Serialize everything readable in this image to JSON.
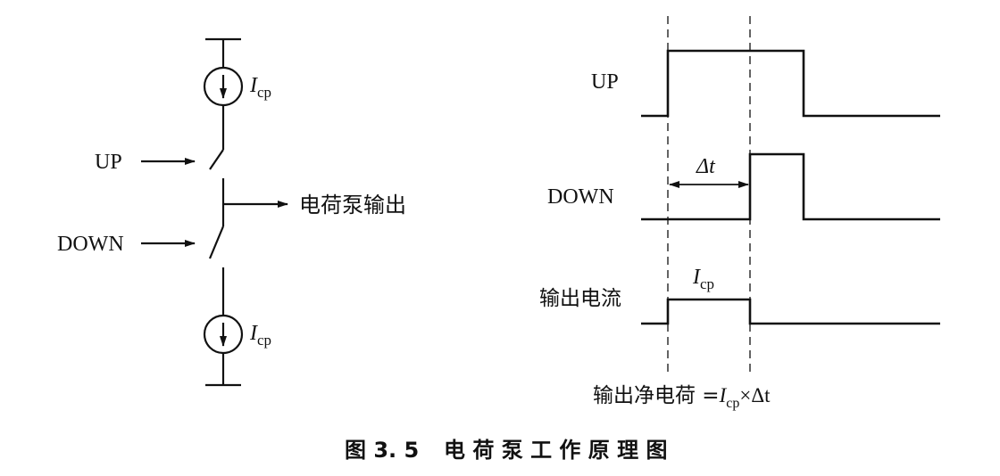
{
  "circuit": {
    "source_top_label": "I",
    "source_top_sub": "cp",
    "source_bottom_label": "I",
    "source_bottom_sub": "cp",
    "up_label": "UP",
    "down_label": "DOWN",
    "output_label": "电荷泵输出"
  },
  "timing": {
    "up_label": "UP",
    "down_label": "DOWN",
    "output_label": "输出电流",
    "delta_t": "Δt",
    "icp_main": "I",
    "icp_sub": "cp",
    "formula_prefix": "输出净电荷 =",
    "formula_i": "I",
    "formula_sub": "cp",
    "formula_suffix": "×Δt"
  },
  "caption": {
    "number": "图 3. 5",
    "title": "电 荷 泵 工 作 原 理 图"
  }
}
